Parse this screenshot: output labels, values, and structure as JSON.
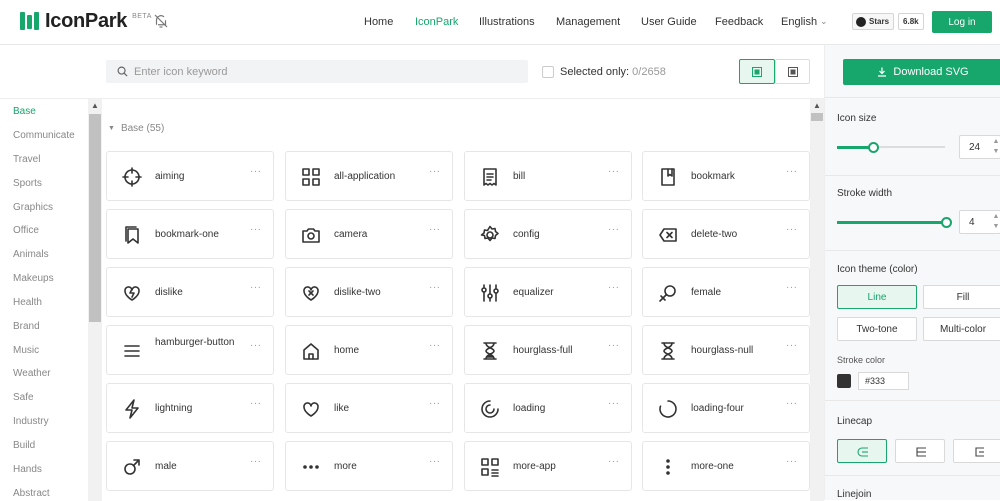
{
  "header": {
    "logo_text": "IconPark",
    "beta_label": "BETA",
    "nav": [
      {
        "label": "Home",
        "active": false
      },
      {
        "label": "IconPark",
        "active": true
      },
      {
        "label": "Illustrations",
        "active": false
      },
      {
        "label": "Management",
        "active": false
      },
      {
        "label": "User Guide",
        "active": false
      },
      {
        "label": "Feedback",
        "active": false
      },
      {
        "label": "English",
        "active": false
      }
    ],
    "github": {
      "stars_label": "Stars",
      "count": "6.8k"
    },
    "login_label": "Log in"
  },
  "toolbar": {
    "search_placeholder": "Enter icon keyword",
    "selected_only_label": "Selected only:",
    "selected_count": "0/2658"
  },
  "sidebar": {
    "categories": [
      "Base",
      "Communicate",
      "Travel",
      "Sports",
      "Graphics",
      "Office",
      "Animals",
      "Makeups",
      "Health",
      "Brand",
      "Music",
      "Weather",
      "Safe",
      "Industry",
      "Build",
      "Hands",
      "Abstract"
    ],
    "active": "Base"
  },
  "section": {
    "title": "Base (55)"
  },
  "icons": [
    {
      "name": "aiming",
      "icon": "aiming-icon"
    },
    {
      "name": "all-application",
      "icon": "all-application-icon"
    },
    {
      "name": "bill",
      "icon": "bill-icon"
    },
    {
      "name": "bookmark",
      "icon": "bookmark-icon"
    },
    {
      "name": "bookmark-one",
      "icon": "bookmark-one-icon"
    },
    {
      "name": "camera",
      "icon": "camera-icon"
    },
    {
      "name": "config",
      "icon": "config-icon"
    },
    {
      "name": "delete-two",
      "icon": "delete-two-icon"
    },
    {
      "name": "dislike",
      "icon": "dislike-icon"
    },
    {
      "name": "dislike-two",
      "icon": "dislike-two-icon"
    },
    {
      "name": "equalizer",
      "icon": "equalizer-icon"
    },
    {
      "name": "female",
      "icon": "female-icon"
    },
    {
      "name": "hamburger-button",
      "icon": "hamburger-button-icon"
    },
    {
      "name": "home",
      "icon": "home-icon"
    },
    {
      "name": "hourglass-full",
      "icon": "hourglass-full-icon"
    },
    {
      "name": "hourglass-null",
      "icon": "hourglass-null-icon"
    },
    {
      "name": "lightning",
      "icon": "lightning-icon"
    },
    {
      "name": "like",
      "icon": "like-icon"
    },
    {
      "name": "loading",
      "icon": "loading-icon"
    },
    {
      "name": "loading-four",
      "icon": "loading-four-icon"
    },
    {
      "name": "male",
      "icon": "male-icon"
    },
    {
      "name": "more",
      "icon": "more-icon"
    },
    {
      "name": "more-app",
      "icon": "more-app-icon"
    },
    {
      "name": "more-one",
      "icon": "more-one-icon"
    }
  ],
  "more_glyph": "···",
  "panel": {
    "download_label": "Download SVG",
    "icon_size_label": "Icon size",
    "icon_size_value": "24",
    "stroke_width_label": "Stroke width",
    "stroke_width_value": "4",
    "theme_label": "Icon theme (color)",
    "themes": [
      "Line",
      "Fill",
      "Two-tone",
      "Multi-color"
    ],
    "active_theme": "Line",
    "stroke_color_label": "Stroke color",
    "stroke_color_value": "#333",
    "linecap_label": "Linecap",
    "linejoin_label": "Linejoin"
  },
  "colors": {
    "accent": "#17a66c",
    "accent_light": "#e7f6ef",
    "stroke": "#333333"
  }
}
